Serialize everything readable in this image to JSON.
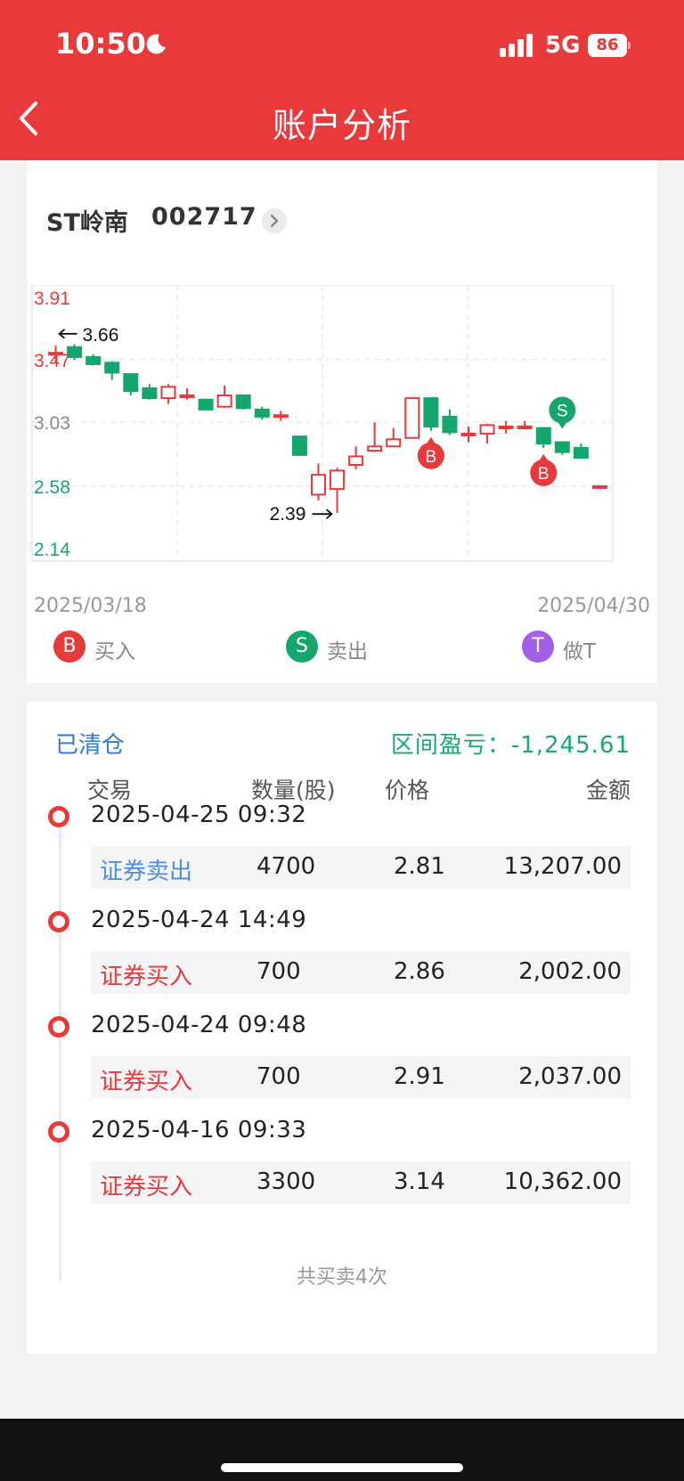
{
  "status_bar": {
    "time": "10:50",
    "network": "5G",
    "battery": "86"
  },
  "nav": {
    "title": "账户分析"
  },
  "stock": {
    "name": "ST岭南",
    "code": "002717"
  },
  "chart_data": {
    "type": "candlestick",
    "y_ticks": [
      "3.91",
      "3.47",
      "3.03",
      "2.58",
      "2.14"
    ],
    "ylim": [
      2.14,
      3.91
    ],
    "x_start_label": "2025/03/18",
    "x_end_label": "2025/04/30",
    "annotations": {
      "high": "3.66",
      "low": "2.39"
    },
    "candles": [
      {
        "o": 3.52,
        "c": 3.52,
        "h": 3.57,
        "l": 3.45
      },
      {
        "o": 3.56,
        "c": 3.49,
        "h": 3.58,
        "l": 3.47
      },
      {
        "o": 3.49,
        "c": 3.44,
        "h": 3.51,
        "l": 3.43
      },
      {
        "o": 3.45,
        "c": 3.38,
        "h": 3.46,
        "l": 3.33
      },
      {
        "o": 3.37,
        "c": 3.25,
        "h": 3.37,
        "l": 3.22
      },
      {
        "o": 3.27,
        "c": 3.2,
        "h": 3.3,
        "l": 3.19
      },
      {
        "o": 3.2,
        "c": 3.28,
        "h": 3.3,
        "l": 3.16
      },
      {
        "o": 3.22,
        "c": 3.22,
        "h": 3.27,
        "l": 3.19
      },
      {
        "o": 3.19,
        "c": 3.12,
        "h": 3.19,
        "l": 3.12
      },
      {
        "o": 3.14,
        "c": 3.22,
        "h": 3.29,
        "l": 3.13
      },
      {
        "o": 3.22,
        "c": 3.13,
        "h": 3.22,
        "l": 3.12
      },
      {
        "o": 3.12,
        "c": 3.07,
        "h": 3.14,
        "l": 3.05
      },
      {
        "o": 3.08,
        "c": 3.08,
        "h": 3.11,
        "l": 3.04
      },
      {
        "o": 2.93,
        "c": 2.8,
        "h": 2.93,
        "l": 2.8
      },
      {
        "o": 2.52,
        "c": 2.66,
        "h": 2.74,
        "l": 2.48
      },
      {
        "o": 2.56,
        "c": 2.69,
        "h": 2.71,
        "l": 2.39
      },
      {
        "o": 2.73,
        "c": 2.79,
        "h": 2.86,
        "l": 2.7
      },
      {
        "o": 2.83,
        "c": 2.86,
        "h": 3.03,
        "l": 2.82
      },
      {
        "o": 2.86,
        "c": 2.91,
        "h": 2.99,
        "l": 2.86
      },
      {
        "o": 2.92,
        "c": 3.2,
        "h": 3.2,
        "l": 2.92
      },
      {
        "o": 3.2,
        "c": 3.0,
        "h": 3.2,
        "l": 2.97
      },
      {
        "o": 3.07,
        "c": 2.96,
        "h": 3.12,
        "l": 2.94
      },
      {
        "o": 2.95,
        "c": 2.95,
        "h": 3.0,
        "l": 2.89
      },
      {
        "o": 2.95,
        "c": 3.01,
        "h": 3.02,
        "l": 2.88
      },
      {
        "o": 3.0,
        "c": 3.0,
        "h": 3.04,
        "l": 2.95
      },
      {
        "o": 3.0,
        "c": 3.0,
        "h": 3.04,
        "l": 2.98
      },
      {
        "o": 2.99,
        "c": 2.88,
        "h": 2.99,
        "l": 2.85
      },
      {
        "o": 2.89,
        "c": 2.82,
        "h": 2.89,
        "l": 2.8
      },
      {
        "o": 2.85,
        "c": 2.78,
        "h": 2.88,
        "l": 2.78
      },
      {
        "o": 2.58,
        "c": 2.58,
        "h": 2.58,
        "l": 2.58
      }
    ],
    "markers": [
      {
        "index": 20,
        "type": "B",
        "price": 2.97
      },
      {
        "index": 26,
        "type": "B",
        "price": 2.85
      },
      {
        "index": 27,
        "type": "S",
        "price": 2.89
      }
    ]
  },
  "legend": {
    "buy_badge": "B",
    "buy_label": "买入",
    "sell_badge": "S",
    "sell_label": "卖出",
    "t_badge": "T",
    "t_label": "做T"
  },
  "colors": {
    "up": "#e8393b",
    "down": "#14a66c",
    "t": "#a35fe6",
    "link": "#2e7bd0"
  },
  "trades": {
    "status": "已清仓",
    "pl_label": "区间盈亏：",
    "pl_value": "-1,245.61",
    "headers": {
      "trade": "交易",
      "qty": "数量(股)",
      "price": "价格",
      "amount": "金额"
    },
    "entries": [
      {
        "time": "2025-04-25 09:32",
        "type": "证券卖出",
        "qty": "4700",
        "price": "2.81",
        "amount": "13,207.00"
      },
      {
        "time": "2025-04-24 14:49",
        "type": "证券买入",
        "qty": "700",
        "price": "2.86",
        "amount": "2,002.00"
      },
      {
        "time": "2025-04-24 09:48",
        "type": "证券买入",
        "qty": "700",
        "price": "2.91",
        "amount": "2,037.00"
      },
      {
        "time": "2025-04-16 09:33",
        "type": "证券买入",
        "qty": "3300",
        "price": "3.14",
        "amount": "10,362.00"
      }
    ],
    "total": "共买卖4次"
  }
}
